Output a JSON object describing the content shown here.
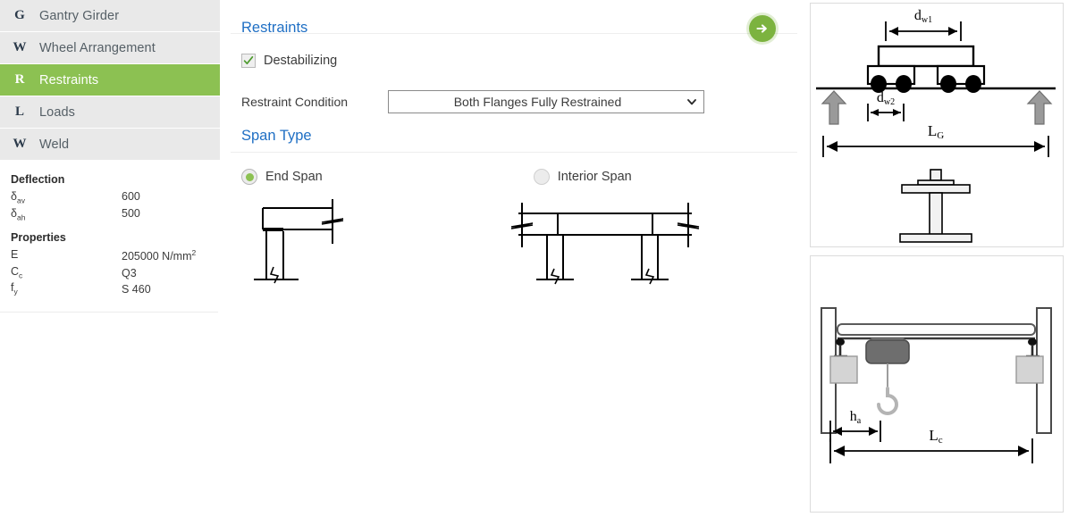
{
  "sidebar": {
    "nav": [
      {
        "letter": "G",
        "label": "Gantry Girder",
        "active": false
      },
      {
        "letter": "W",
        "label": "Wheel Arrangement",
        "active": false
      },
      {
        "letter": "R",
        "label": "Restraints",
        "active": true
      },
      {
        "letter": "L",
        "label": "Loads",
        "active": false
      },
      {
        "letter": "W",
        "label": "Weld",
        "active": false
      }
    ],
    "deflection": {
      "heading": "Deflection",
      "rows": [
        {
          "key": "δ",
          "key_sub": "av",
          "value": "600"
        },
        {
          "key": "δ",
          "key_sub": "ah",
          "value": "500"
        }
      ]
    },
    "properties": {
      "heading": "Properties",
      "rows": [
        {
          "key": "E",
          "key_sub": "",
          "value": "205000 N/mm",
          "value_sup": "2"
        },
        {
          "key": "C",
          "key_sub": "c",
          "value": "Q3",
          "value_sup": ""
        },
        {
          "key": "f",
          "key_sub": "y",
          "value": "S 460",
          "value_sup": ""
        }
      ]
    }
  },
  "main": {
    "title": "Restraints",
    "next_icon": "arrow-right-circle-icon",
    "destabilizing": {
      "label": "Destabilizing",
      "checked": true,
      "check_icon": "check-icon"
    },
    "restraint_condition": {
      "label": "Restraint Condition",
      "value": "Both Flanges Fully Restrained",
      "chevron_icon": "chevron-down-icon"
    },
    "span_type": {
      "heading": "Span Type",
      "options": [
        {
          "label": "End Span",
          "selected": true
        },
        {
          "label": "Interior Span",
          "selected": false
        }
      ]
    }
  },
  "figures": {
    "top": {
      "name": "gantry-girder-wheel-load-diagram",
      "labels": {
        "dw1": "d",
        "dw1_sub": "w1",
        "dw2": "d",
        "dw2_sub": "w2",
        "lg": "L",
        "lg_sub": "G"
      }
    },
    "bottom": {
      "name": "overhead-crane-span-diagram",
      "labels": {
        "ha": "h",
        "ha_sub": "a",
        "lc": "L",
        "lc_sub": "c"
      }
    }
  },
  "colors": {
    "accent_green": "#8cc152",
    "button_green": "#7cb33f",
    "link_blue": "#1f6fc4",
    "nav_bg": "#e9e9e9"
  }
}
